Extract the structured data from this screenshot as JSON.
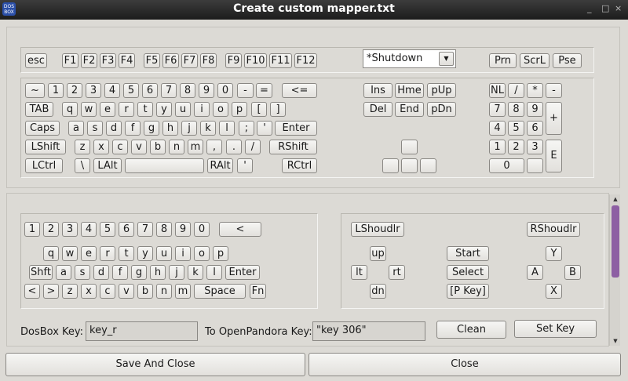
{
  "window": {
    "title": "Create custom mapper.txt",
    "controls": [
      "_",
      "□",
      "×"
    ]
  },
  "fkeys": [
    "esc",
    "F1",
    "F2",
    "F3",
    "F4",
    "F5",
    "F6",
    "F7",
    "F8",
    "F9",
    "F10",
    "F11",
    "F12"
  ],
  "preset": {
    "selected": "*Shutdown",
    "arrow": "▼"
  },
  "syskeys": [
    "Prn",
    "ScrL",
    "Pse"
  ],
  "keyboard": {
    "row1": [
      "~",
      "1",
      "2",
      "3",
      "4",
      "5",
      "6",
      "7",
      "8",
      "9",
      "0",
      "-",
      "=",
      "<="
    ],
    "row2": [
      "TAB",
      "q",
      "w",
      "e",
      "r",
      "t",
      "y",
      "u",
      "i",
      "o",
      "p",
      "[",
      "]"
    ],
    "row3": [
      "Caps",
      "a",
      "s",
      "d",
      "f",
      "g",
      "h",
      "j",
      "k",
      "l",
      ";",
      "'",
      "Enter"
    ],
    "row4": [
      "LShift",
      "z",
      "x",
      "c",
      "v",
      "b",
      "n",
      "m",
      ",",
      ".",
      "/",
      "RShift"
    ],
    "row5": [
      "LCtrl",
      "\\",
      "LAlt",
      "",
      "RAlt",
      "'",
      "RCtrl"
    ]
  },
  "nav": {
    "row1": [
      "Ins",
      "Hme",
      "pUp"
    ],
    "row2": [
      "Del",
      "End",
      "pDn"
    ]
  },
  "numpad": {
    "row1": [
      "NL",
      "/",
      "*",
      "-"
    ],
    "row2": [
      "7",
      "8",
      "9"
    ],
    "row3": [
      "4",
      "5",
      "6"
    ],
    "row4": [
      "1",
      "2",
      "3"
    ],
    "zero": "0",
    "plus": "+",
    "enter": "E"
  },
  "pandora": {
    "nums": [
      "1",
      "2",
      "3",
      "4",
      "5",
      "6",
      "7",
      "8",
      "9",
      "0"
    ],
    "backspace": "<",
    "row_q": [
      "q",
      "w",
      "e",
      "r",
      "t",
      "y",
      "u",
      "i",
      "o",
      "p"
    ],
    "row_a": [
      "Shft",
      "a",
      "s",
      "d",
      "f",
      "g",
      "h",
      "j",
      "k",
      "l",
      "Enter"
    ],
    "row_z": [
      "<",
      ">",
      "z",
      "x",
      "c",
      "v",
      "b",
      "n",
      "m",
      "Space",
      "Fn"
    ]
  },
  "controls": {
    "lshoulder": "LShoudlr",
    "rshoulder": "RShoudlr",
    "up": "up",
    "left": "lt",
    "right": "rt",
    "down": "dn",
    "start": "Start",
    "select": "Select",
    "pkey": "[P Key]",
    "y": "Y",
    "a": "A",
    "b": "B",
    "x": "X"
  },
  "mapping": {
    "dosbox_label": "DosBox Key:",
    "dosbox_value": "key_r",
    "pandora_label": "To OpenPandora Key:",
    "pandora_value": "\"key 306\"",
    "clean": "Clean",
    "set": "Set Key"
  },
  "footer": {
    "save": "Save And Close",
    "close": "Close"
  }
}
